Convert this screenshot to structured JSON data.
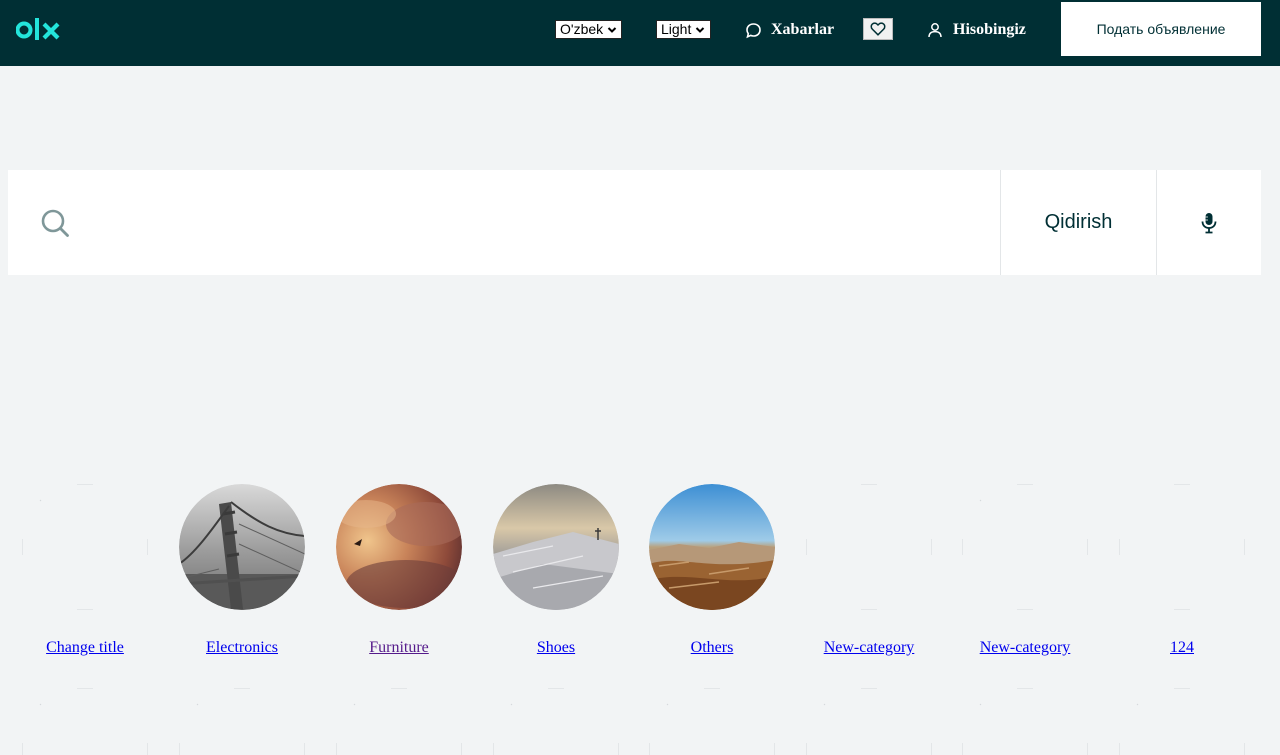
{
  "header": {
    "logo_text": "olx",
    "language_select": "O'zbek",
    "theme_select": "Light",
    "messages_label": "Xabarlar",
    "account_label": "Hisobingiz",
    "post_ad_label": "Подать объявление"
  },
  "search": {
    "value": "",
    "placeholder": "",
    "button_label": "Qidirish"
  },
  "categories": [
    {
      "label": "Change title",
      "image": "none"
    },
    {
      "label": "Electronics",
      "image": "bridge-grayscale"
    },
    {
      "label": "Furniture",
      "image": "sunset-clouds"
    },
    {
      "label": "Shoes",
      "image": "snowy-mountain"
    },
    {
      "label": "Others",
      "image": "desert-landscape"
    },
    {
      "label": "New-category",
      "image": "none"
    },
    {
      "label": "New-category",
      "image": "none"
    },
    {
      "label": "124",
      "image": "none"
    }
  ],
  "colors": {
    "header_bg": "#002f34",
    "accent": "#23e5db",
    "page_bg": "#f2f4f5",
    "link": "#0000ee",
    "link_visited": "#551a8b"
  }
}
